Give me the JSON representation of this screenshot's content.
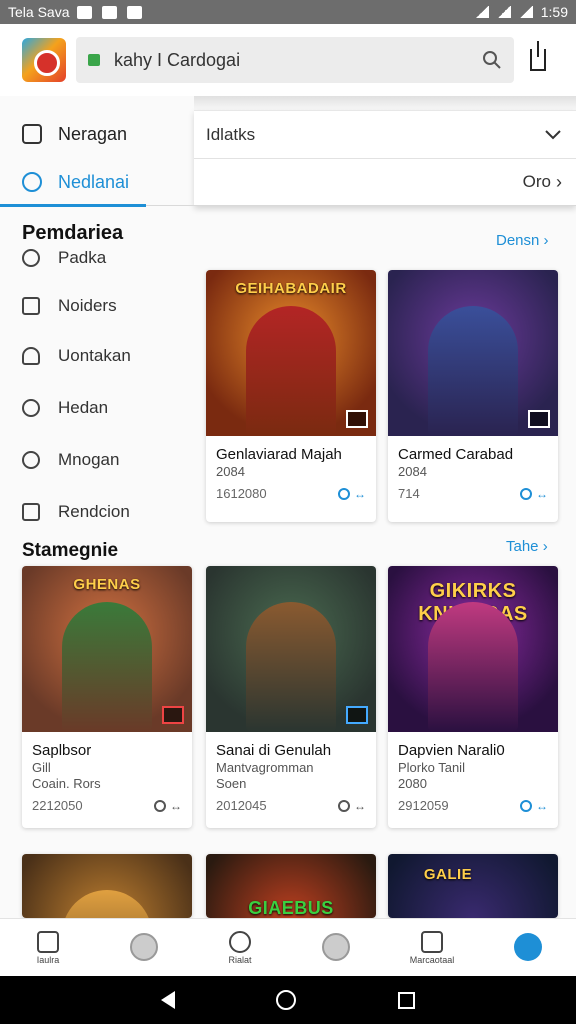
{
  "status_bar": {
    "carrier": "Tela Sava",
    "time": "1:59"
  },
  "app_bar": {
    "url_text": "kahy I Cardogai"
  },
  "dropdown": {
    "field_text": "Idlatks",
    "action_text": "Oro"
  },
  "nav": {
    "items": [
      {
        "label": "Neragan",
        "icon": "home-icon"
      },
      {
        "label": "Nedlanai",
        "icon": "search-icon",
        "active": true
      }
    ]
  },
  "section1": {
    "title": "Pemdariea",
    "link": "Densn",
    "categories": [
      "Padka",
      "Noiders",
      "Uontakan",
      "Hedan",
      "Mnogan",
      "Rendcion"
    ]
  },
  "section2": {
    "title": "Stamegnie",
    "link": "Tahe"
  },
  "cards": [
    {
      "art_title": "GEIHABADAIR",
      "name": "Genlaviarad Majah",
      "sub": "2084",
      "meta": "1612080",
      "rating": "↔",
      "colors": [
        "#7a2a10",
        "#e88a2a",
        "#b32525"
      ]
    },
    {
      "art_title": "",
      "name": "Carmed Carabad",
      "sub": "2084",
      "meta": "714",
      "rating": "↔",
      "rating_blue": true,
      "colors": [
        "#2a2350",
        "#6b3a9a",
        "#3a4f9a"
      ]
    },
    {
      "art_title": "GHENAS",
      "name": "Saplbsor",
      "sub": "Gill",
      "sub2": "Coain. Rors",
      "meta": "2212050",
      "rating": "↔",
      "colors": [
        "#6a3a28",
        "#d07040",
        "#3a7a3a"
      ]
    },
    {
      "art_title": "",
      "name": "Sanai di Genulah",
      "sub": "Mantvagromman",
      "sub2": "Soen",
      "meta": "2012045",
      "rating": "↔",
      "colors": [
        "#2a3530",
        "#4a6a50",
        "#8a5a30"
      ]
    },
    {
      "art_title": "GIKIRKS KNIRACAS",
      "name": "Dapvien Narali0",
      "sub": "Plorko Tanil",
      "sub2": "2080",
      "meta": "2912059",
      "rating": "↔",
      "rating_blue": true,
      "colors": [
        "#2a1040",
        "#8a2aa0",
        "#c03a80"
      ]
    },
    {
      "art_title": "",
      "colors": [
        "#4a3018",
        "#c08030",
        "#e0a040"
      ]
    },
    {
      "art_title": "GIAEBUS",
      "colors": [
        "#2a1a10",
        "#c04020",
        "#3a8a30"
      ]
    },
    {
      "art_title": "GALIE",
      "colors": [
        "#101830",
        "#3a2a70",
        "#c03030"
      ]
    }
  ],
  "bottom_nav": {
    "items": [
      {
        "label": "Iaulra",
        "icon": "home-icon"
      },
      {
        "label": "",
        "icon": "globe-icon"
      },
      {
        "label": "Rialat",
        "icon": "search-icon"
      },
      {
        "label": "",
        "icon": "globe-icon"
      },
      {
        "label": "Marcaotaal",
        "icon": "book-icon"
      },
      {
        "label": "",
        "icon": "compass-icon"
      }
    ]
  }
}
